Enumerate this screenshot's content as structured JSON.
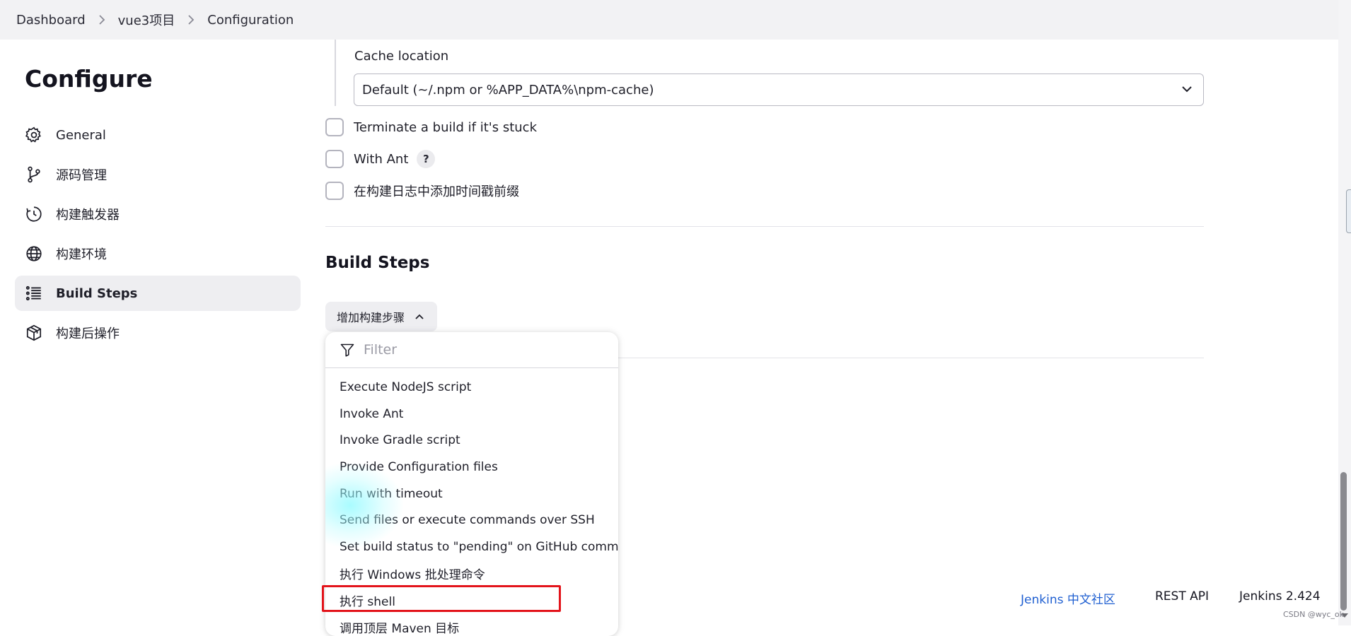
{
  "breadcrumb": {
    "items": [
      "Dashboard",
      "vue3项目",
      "Configuration"
    ]
  },
  "sidebar": {
    "title": "Configure",
    "items": [
      {
        "label": "General",
        "icon": "gear-icon"
      },
      {
        "label": "源码管理",
        "icon": "branch-icon"
      },
      {
        "label": "构建触发器",
        "icon": "clock-icon"
      },
      {
        "label": "构建环境",
        "icon": "globe-icon"
      },
      {
        "label": "Build Steps",
        "icon": "list-icon",
        "active": true
      },
      {
        "label": "构建后操作",
        "icon": "box-icon"
      }
    ]
  },
  "main": {
    "cache_label": "Cache location",
    "cache_select_value": "Default (~/.npm or %APP_DATA%\\npm-cache)",
    "checkboxes": [
      {
        "label": "Terminate a build if it's stuck",
        "checked": false
      },
      {
        "label": "With Ant",
        "checked": false,
        "help": "?"
      },
      {
        "label": "在构建日志中添加时间戳前缀",
        "checked": false
      }
    ],
    "section_title": "Build Steps",
    "add_step_label": "增加构建步骤"
  },
  "dropdown": {
    "filter_placeholder": "Filter",
    "items": [
      "Execute NodeJS script",
      "Invoke Ant",
      "Invoke Gradle script",
      "Provide Configuration files",
      "Run with timeout",
      "Send files or execute commands over SSH",
      "Set build status to \"pending\" on GitHub commit",
      "执行 Windows 批处理命令",
      "执行 shell",
      "调用顶层 Maven 目标"
    ],
    "highlighted_item": "执行 shell"
  },
  "footer": {
    "community": "Jenkins 中文社区",
    "rest_api": "REST API",
    "version": "Jenkins 2.424"
  },
  "watermark": "CSDN @wyc_ok",
  "colors": {
    "accent_link": "#1f5fd1",
    "highlight_border": "#e3141b",
    "active_nav_bg": "#eeeef1"
  }
}
